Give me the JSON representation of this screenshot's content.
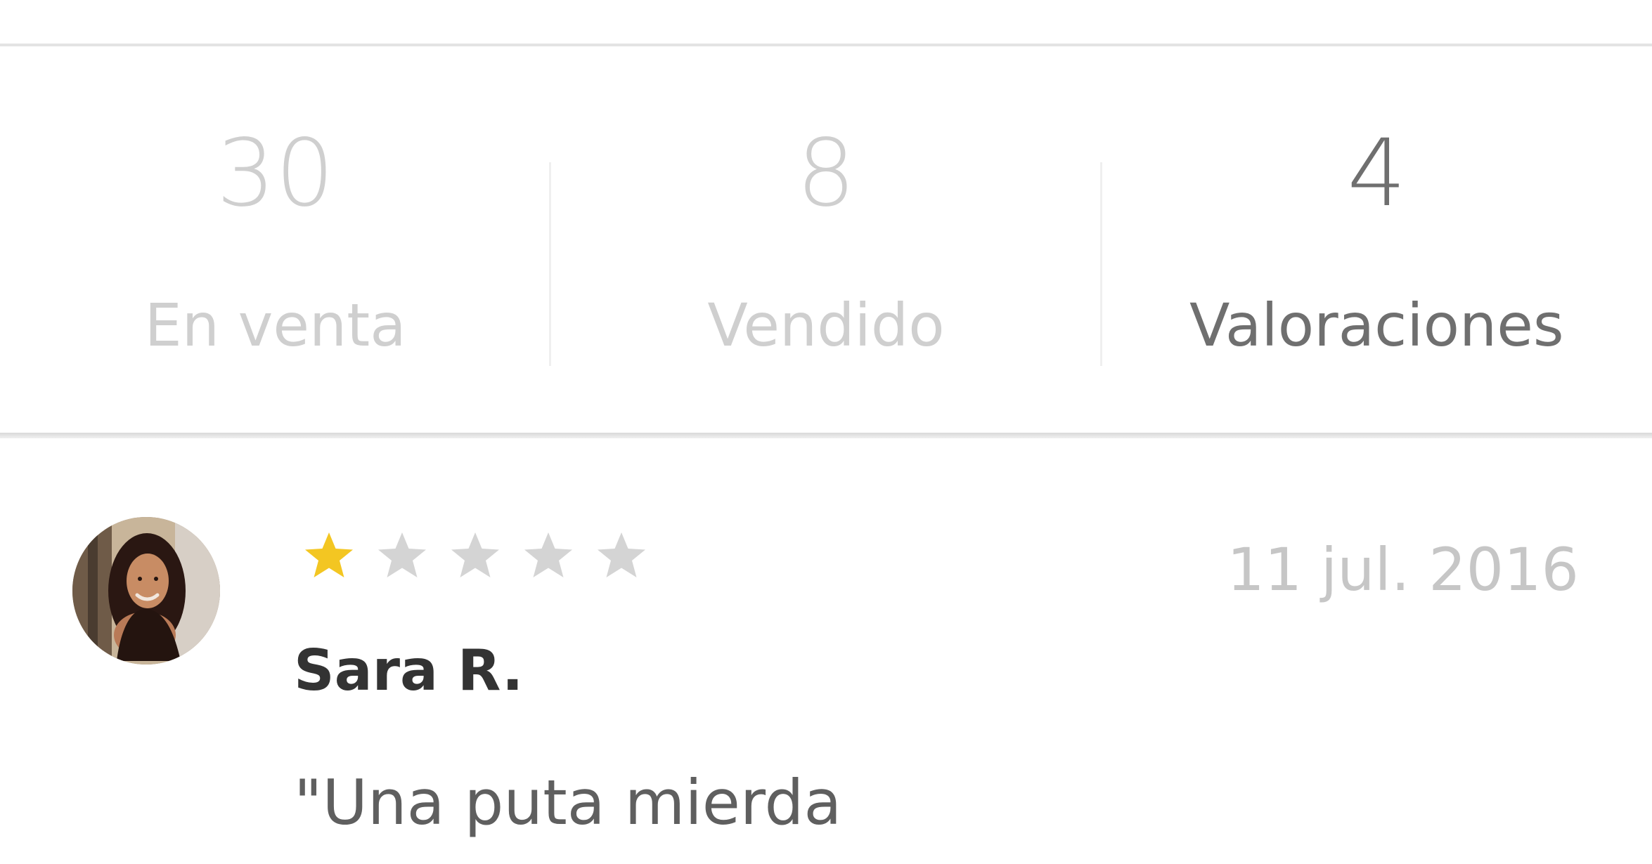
{
  "stats": {
    "items": [
      {
        "count": "30",
        "label": "En venta",
        "active": false
      },
      {
        "count": "8",
        "label": "Vendido",
        "active": false
      },
      {
        "count": "4",
        "label": "Valoraciones",
        "active": true
      }
    ]
  },
  "review": {
    "reviewer_name": "Sara R.",
    "date": "11 jul. 2016",
    "rating": 1,
    "max_rating": 5,
    "comment": "\"Una puta mierda",
    "avatar_icon": "profile-photo"
  },
  "colors": {
    "star_filled": "#f3c622",
    "star_empty": "#d4d4d4",
    "active_text": "#6f6f6f",
    "inactive_text": "#cfcfcf",
    "date_text": "#c6c6c6",
    "name_text": "#333333",
    "comment_text": "#5f5f5f"
  }
}
